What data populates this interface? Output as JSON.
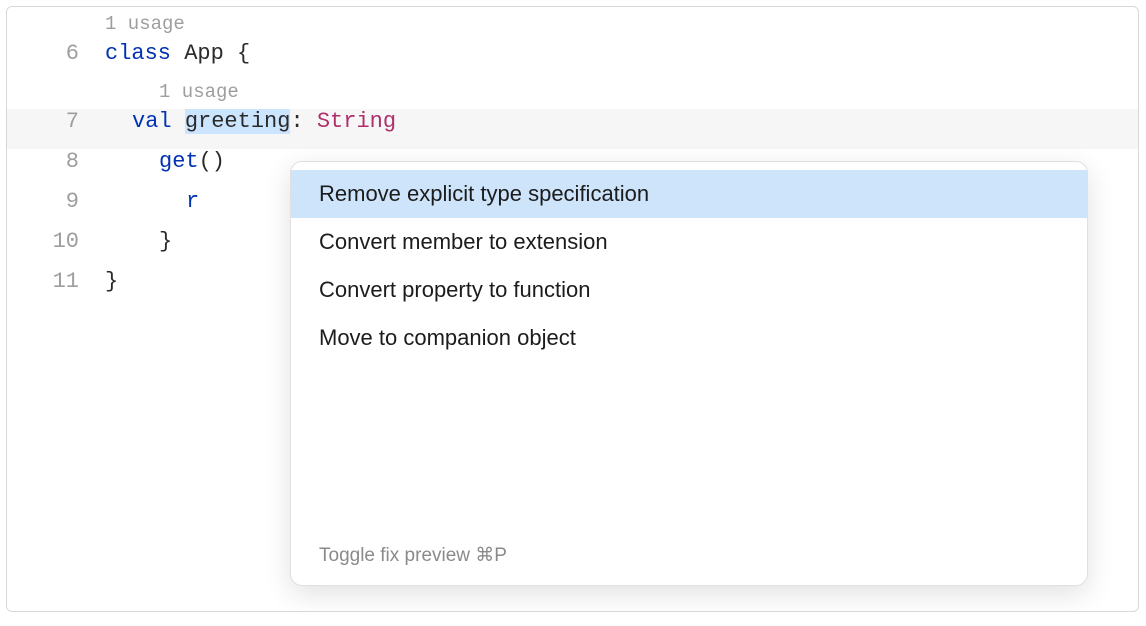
{
  "editor": {
    "inlays": {
      "class": "1 usage",
      "greeting": "1 usage"
    },
    "lines": [
      {
        "num": "6",
        "indent": 0,
        "tokens": [
          {
            "t": "class ",
            "cls": "kw"
          },
          {
            "t": "App ",
            "cls": "ident"
          },
          {
            "t": "{",
            "cls": "punct"
          }
        ]
      },
      {
        "num": "7",
        "indent": 2,
        "highlighted": true,
        "tokens": [
          {
            "t": "val ",
            "cls": "kw"
          },
          {
            "t": "greeting",
            "cls": "ident",
            "selected": true
          },
          {
            "t": ": ",
            "cls": "punct"
          },
          {
            "t": "String",
            "cls": "typ"
          }
        ]
      },
      {
        "num": "8",
        "indent": 4,
        "tokens": [
          {
            "t": "get",
            "cls": "fn-name"
          },
          {
            "t": "()",
            "cls": "punct"
          }
        ]
      },
      {
        "num": "9",
        "indent": 6,
        "tokens": [
          {
            "t": "r",
            "cls": "kw"
          }
        ]
      },
      {
        "num": "10",
        "indent": 4,
        "tokens": [
          {
            "t": "}",
            "cls": "punct"
          }
        ]
      },
      {
        "num": "11",
        "indent": 0,
        "tokens": [
          {
            "t": "}",
            "cls": "punct"
          }
        ]
      }
    ]
  },
  "popup": {
    "items": [
      {
        "label": "Remove explicit type specification",
        "selected": true
      },
      {
        "label": "Convert member to extension",
        "selected": false
      },
      {
        "label": "Convert property to function",
        "selected": false
      },
      {
        "label": "Move to companion object",
        "selected": false
      }
    ],
    "footer": "Toggle fix preview ⌘P"
  }
}
